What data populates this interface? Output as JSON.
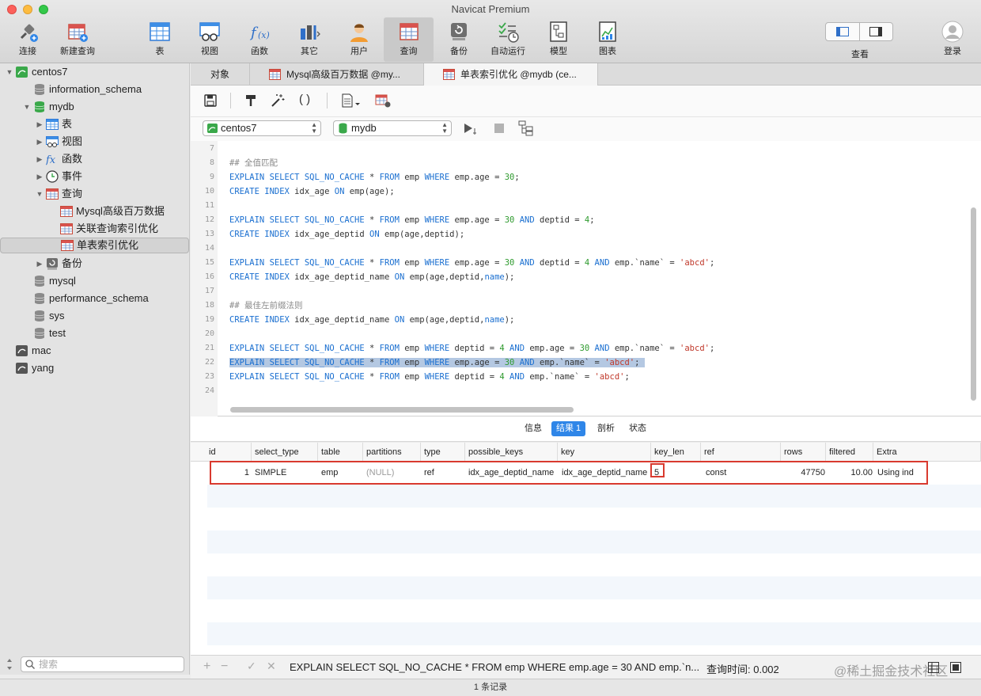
{
  "window": {
    "title": "Navicat Premium"
  },
  "toolbar": {
    "connect": "连接",
    "new_query": "新建查询",
    "table": "表",
    "view": "视图",
    "function": "函数",
    "other": "其它",
    "user": "用户",
    "query": "查询",
    "backup": "备份",
    "automation": "自动运行",
    "model": "模型",
    "chart": "图表",
    "view_mode": "查看",
    "login": "登录"
  },
  "sidebar": {
    "conn_centos7": "centos7",
    "db_information_schema": "information_schema",
    "db_mydb": "mydb",
    "mydb_tables": "表",
    "mydb_views": "视图",
    "mydb_functions": "函数",
    "mydb_events": "事件",
    "mydb_queries": "查询",
    "query_1": "Mysql高级百万数据",
    "query_2": "关联查询索引优化",
    "query_3": "单表索引优化",
    "mydb_backups": "备份",
    "db_mysql": "mysql",
    "db_performance_schema": "performance_schema",
    "db_sys": "sys",
    "db_test": "test",
    "conn_mac": "mac",
    "conn_yang": "yang",
    "search_placeholder": "搜索"
  },
  "tabs": {
    "objects": "对象",
    "tab1": "Mysql高级百万数据 @my...",
    "tab2": "单表索引优化 @mydb (ce..."
  },
  "selectors": {
    "connection": "centos7",
    "database": "mydb"
  },
  "editor": {
    "line_numbers": [
      "7",
      "8",
      "9",
      "10",
      "11",
      "12",
      "13",
      "14",
      "15",
      "16",
      "17",
      "18",
      "19",
      "20",
      "21",
      "22",
      "23",
      "24"
    ],
    "comment_full_match": "## 全值匹配",
    "comment_leftmost_prefix": "## 最佳左前缀法则"
  },
  "result_tabs": {
    "info": "信息",
    "result1": "结果 1",
    "profile": "剖析",
    "status": "状态"
  },
  "grid": {
    "columns": [
      "id",
      "select_type",
      "table",
      "partitions",
      "type",
      "possible_keys",
      "key",
      "key_len",
      "ref",
      "rows",
      "filtered",
      "Extra"
    ],
    "row": {
      "id": "1",
      "select_type": "SIMPLE",
      "table": "emp",
      "partitions": "(NULL)",
      "type": "ref",
      "possible_keys": "idx_age_deptid_name",
      "key": "idx_age_deptid_name",
      "key_len": "5",
      "ref": "const",
      "rows": "47750",
      "filtered": "10.00",
      "Extra": "Using ind"
    }
  },
  "bottom": {
    "sql": "EXPLAIN SELECT SQL_NO_CACHE * FROM emp WHERE emp.age = 30 AND emp.`n...",
    "query_time": "查询时间: 0.002",
    "watermark": "@稀土掘金技术社区"
  },
  "status": {
    "records": "1 条记录"
  }
}
